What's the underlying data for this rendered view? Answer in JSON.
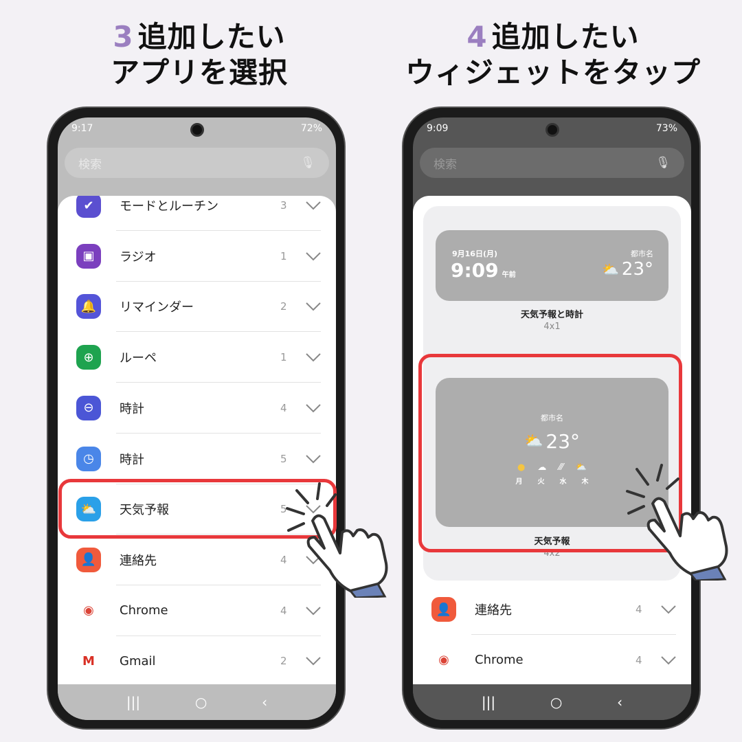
{
  "left": {
    "step": "3",
    "line1": "追加したい",
    "line2": "アプリを選択",
    "status": {
      "time": "9:17",
      "battery": "72%"
    },
    "search_placeholder": "検索",
    "apps": [
      {
        "label": "モードとルーチン",
        "count": "3",
        "icon": "modes-routines-icon",
        "color": "#5b4fd0"
      },
      {
        "label": "ラジオ",
        "count": "1",
        "icon": "radio-icon",
        "color": "#7b3fbe"
      },
      {
        "label": "リマインダー",
        "count": "2",
        "icon": "bell-icon",
        "color": "#5454d8"
      },
      {
        "label": "ルーペ",
        "count": "1",
        "icon": "magnifier-icon",
        "color": "#1ea34f"
      },
      {
        "label": "時計",
        "count": "4",
        "icon": "clock-minus-icon",
        "color": "#4b56d6"
      },
      {
        "label": "時計",
        "count": "5",
        "icon": "clock-icon",
        "color": "#4a86e8"
      },
      {
        "label": "天気予報",
        "count": "5",
        "icon": "weather-icon",
        "color": "#2aa0e8"
      },
      {
        "label": "連絡先",
        "count": "4",
        "icon": "contacts-icon",
        "color": "#f05a3c"
      },
      {
        "label": "Chrome",
        "count": "4",
        "icon": "chrome-icon",
        "color": "#ffffff"
      },
      {
        "label": "Gmail",
        "count": "2",
        "icon": "gmail-icon",
        "color": "#ffffff"
      }
    ]
  },
  "right": {
    "step": "4",
    "line1": "追加したい",
    "line2": "ウィジェットをタップ",
    "status": {
      "time": "9:09",
      "battery": "73%"
    },
    "search_placeholder": "検索",
    "widget1": {
      "date": "9月16日(月)",
      "time": "9:09",
      "ampm": "午前",
      "city": "都市名",
      "temp": "23°",
      "name": "天気予報と時計",
      "size": "4x1"
    },
    "widget2": {
      "city": "都市名",
      "temp": "23°",
      "days": [
        "月",
        "火",
        "水",
        "木"
      ],
      "name": "天気予報",
      "size": "4x2"
    },
    "apps": [
      {
        "label": "連絡先",
        "count": "4",
        "icon": "contacts-icon",
        "color": "#f05a3c"
      },
      {
        "label": "Chrome",
        "count": "4",
        "icon": "chrome-icon",
        "color": "#ffffff"
      }
    ]
  },
  "nav": {
    "recents": "|||",
    "home": "○",
    "back": "‹"
  },
  "colors": {
    "accent": "#9b7fc0",
    "highlight": "#e8383b"
  }
}
